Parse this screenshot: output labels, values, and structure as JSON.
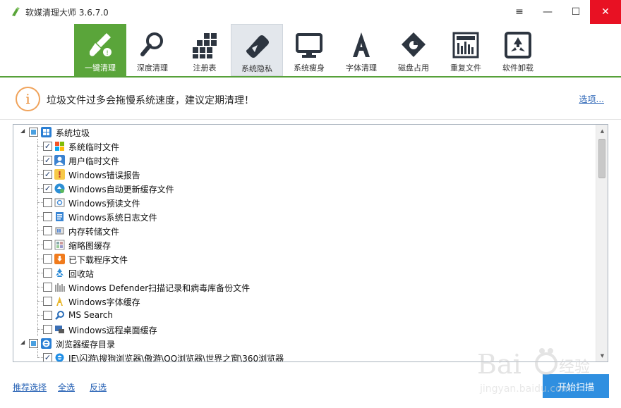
{
  "window": {
    "title": "软媒清理大师 3.6.7.0"
  },
  "window_controls": {
    "menu": "≡",
    "minimize": "—",
    "maximize": "☐",
    "close": "✕"
  },
  "toolbar": {
    "tabs": [
      {
        "label": "一键清理",
        "icon": "broom-icon",
        "active": true
      },
      {
        "label": "深度清理",
        "icon": "magnifier-icon"
      },
      {
        "label": "注册表",
        "icon": "registry-grid-icon"
      },
      {
        "label": "系统隐私",
        "icon": "eraser-icon",
        "hovered": true
      },
      {
        "label": "系统瘦身",
        "icon": "monitor-icon"
      },
      {
        "label": "字体清理",
        "icon": "font-a-icon"
      },
      {
        "label": "磁盘占用",
        "icon": "disk-chart-icon"
      },
      {
        "label": "重复文件",
        "icon": "duplicate-files-icon"
      },
      {
        "label": "软件卸载",
        "icon": "recycle-box-icon"
      }
    ]
  },
  "notice": {
    "icon_glyph": "i",
    "text": "垃圾文件过多会拖慢系统速度，建议定期清理！",
    "options_link": "选项..."
  },
  "tree": {
    "groups": [
      {
        "label": "系统垃圾",
        "checked": "partial",
        "items": [
          {
            "label": "系统临时文件",
            "checked": true,
            "icon": "windows-flag-icon"
          },
          {
            "label": "用户临时文件",
            "checked": true,
            "icon": "user-icon"
          },
          {
            "label": "Windows错误报告",
            "checked": true,
            "icon": "error-report-icon"
          },
          {
            "label": "Windows自动更新缓存文件",
            "checked": true,
            "icon": "windows-update-icon"
          },
          {
            "label": "Windows预读文件",
            "checked": false,
            "icon": "prefetch-icon"
          },
          {
            "label": "Windows系统日志文件",
            "checked": false,
            "icon": "log-file-icon"
          },
          {
            "label": "内存转储文件",
            "checked": false,
            "icon": "memory-dump-icon"
          },
          {
            "label": "缩略图缓存",
            "checked": false,
            "icon": "thumbnail-icon"
          },
          {
            "label": "已下载程序文件",
            "checked": false,
            "icon": "download-icon"
          },
          {
            "label": "回收站",
            "checked": false,
            "icon": "recycle-bin-icon"
          },
          {
            "label": "Windows Defender扫描记录和病毒库备份文件",
            "checked": false,
            "icon": "defender-icon"
          },
          {
            "label": "Windows字体缓存",
            "checked": false,
            "icon": "font-cache-icon"
          },
          {
            "label": "MS Search",
            "checked": false,
            "icon": "search-icon"
          },
          {
            "label": "Windows远程桌面缓存",
            "checked": false,
            "icon": "remote-desktop-icon"
          }
        ]
      },
      {
        "label": "浏览器缓存目录",
        "checked": "partial",
        "items": [
          {
            "label": "IE\\闪游\\搜狗浏览器\\傲游\\QQ浏览器\\世界之窗\\360浏览器",
            "checked": true,
            "icon": "ie-icon"
          }
        ]
      }
    ]
  },
  "footer": {
    "recommend": "推荐选择",
    "select_all": "全选",
    "invert": "反选",
    "primary_button": "开始扫描"
  },
  "colors": {
    "accent_green": "#5aa53a",
    "primary_blue": "#2f8fe0",
    "link_blue": "#2a64b6",
    "close_red": "#e81123"
  }
}
